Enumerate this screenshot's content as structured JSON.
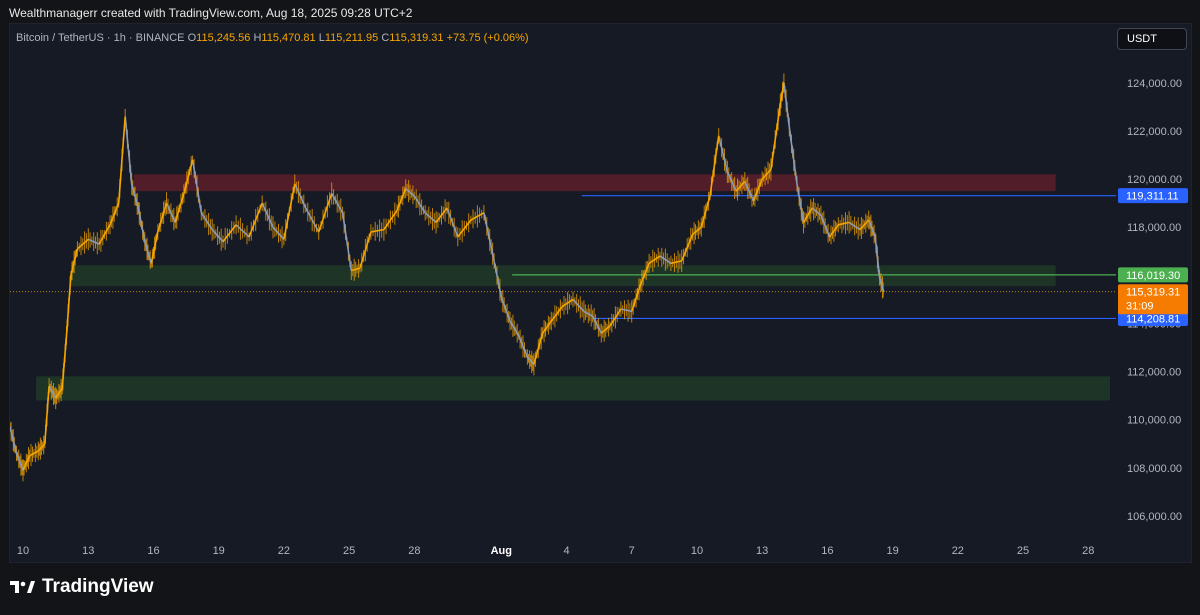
{
  "header": {
    "attribution": "Wealthmanagerr created with TradingView.com, Aug 18, 2025 09:28 UTC+2"
  },
  "symbol": {
    "name": "Bitcoin / TetherUS · 1h · BINANCE",
    "open_label": "O",
    "open": "115,245.56",
    "high_label": "H",
    "high": "115,470.81",
    "low_label": "L",
    "low": "115,211.95",
    "close_label": "C",
    "close": "115,319.31",
    "change": "+73.75 (+0.06%)"
  },
  "currency_button": "USDT",
  "logo": {
    "text": "TradingView"
  },
  "colors": {
    "background": "#161a25",
    "candle_up": "#f7a600",
    "candle_down": "#8a9bb8",
    "resistance_zone": "#5a1f29",
    "support_zone": "#1f3a28",
    "level_blue": "#2962ff",
    "level_green": "#4caf50"
  },
  "chart_data": {
    "type": "line",
    "instrument": "Bitcoin / TetherUS",
    "timeframe": "1h",
    "exchange": "BINANCE",
    "ylim": [
      105000,
      125200
    ],
    "y_ticks": [
      "106,000.00",
      "108,000.00",
      "110,000.00",
      "112,000.00",
      "114,000.00",
      "116,000.00",
      "118,000.00",
      "120,000.00",
      "122,000.00",
      "124,000.00"
    ],
    "y_tick_values": [
      106000,
      108000,
      110000,
      112000,
      114000,
      116000,
      118000,
      120000,
      122000,
      124000
    ],
    "x_ticks": [
      "10",
      "13",
      "16",
      "19",
      "22",
      "25",
      "28",
      "Aug",
      "4",
      "7",
      "10",
      "13",
      "16",
      "19",
      "22",
      "25",
      "28"
    ],
    "x_tick_days": [
      10,
      13,
      16,
      19,
      22,
      25,
      28,
      32,
      35,
      38,
      41,
      44,
      47,
      50,
      53,
      56,
      59
    ],
    "x_start_day": 9.4,
    "x_end_day": 60,
    "series": [
      {
        "points": [
          [
            9.4,
            109700
          ],
          [
            9.7,
            108600
          ],
          [
            10.0,
            107900
          ],
          [
            10.3,
            108500
          ],
          [
            10.7,
            108700
          ],
          [
            11.0,
            109000
          ],
          [
            11.2,
            111400
          ],
          [
            11.5,
            110900
          ],
          [
            11.8,
            111300
          ],
          [
            12.0,
            113500
          ],
          [
            12.2,
            116000
          ],
          [
            12.5,
            117100
          ],
          [
            13.0,
            117500
          ],
          [
            13.5,
            117300
          ],
          [
            14.0,
            118100
          ],
          [
            14.4,
            119000
          ],
          [
            14.7,
            122600
          ],
          [
            15.0,
            119800
          ],
          [
            15.3,
            118800
          ],
          [
            15.6,
            117400
          ],
          [
            15.9,
            116500
          ],
          [
            16.2,
            117800
          ],
          [
            16.6,
            119000
          ],
          [
            17.0,
            118200
          ],
          [
            17.4,
            119400
          ],
          [
            17.8,
            120800
          ],
          [
            18.2,
            118600
          ],
          [
            18.7,
            117900
          ],
          [
            19.2,
            117400
          ],
          [
            19.8,
            118100
          ],
          [
            20.4,
            117600
          ],
          [
            21.0,
            119000
          ],
          [
            21.5,
            118000
          ],
          [
            22.0,
            117500
          ],
          [
            22.5,
            119800
          ],
          [
            23.0,
            118800
          ],
          [
            23.6,
            117800
          ],
          [
            24.2,
            119400
          ],
          [
            24.7,
            118600
          ],
          [
            25.1,
            116200
          ],
          [
            25.5,
            116300
          ],
          [
            26.0,
            117800
          ],
          [
            26.6,
            117900
          ],
          [
            27.2,
            118700
          ],
          [
            27.6,
            119600
          ],
          [
            28.0,
            119300
          ],
          [
            28.5,
            118600
          ],
          [
            29.0,
            118200
          ],
          [
            29.5,
            118800
          ],
          [
            30.0,
            117600
          ],
          [
            30.6,
            118300
          ],
          [
            31.2,
            118600
          ],
          [
            31.6,
            116900
          ],
          [
            32.0,
            115100
          ],
          [
            32.4,
            114100
          ],
          [
            32.8,
            113500
          ],
          [
            33.2,
            112600
          ],
          [
            33.5,
            112300
          ],
          [
            33.9,
            113600
          ],
          [
            34.3,
            114100
          ],
          [
            34.8,
            114700
          ],
          [
            35.3,
            115000
          ],
          [
            35.8,
            114500
          ],
          [
            36.2,
            114300
          ],
          [
            36.6,
            113600
          ],
          [
            37.0,
            113900
          ],
          [
            37.5,
            114600
          ],
          [
            38.0,
            114500
          ],
          [
            38.4,
            115600
          ],
          [
            38.8,
            116500
          ],
          [
            39.3,
            116800
          ],
          [
            39.8,
            116500
          ],
          [
            40.3,
            116600
          ],
          [
            40.8,
            117700
          ],
          [
            41.2,
            118000
          ],
          [
            41.6,
            119300
          ],
          [
            42.0,
            121800
          ],
          [
            42.4,
            120300
          ],
          [
            42.8,
            119500
          ],
          [
            43.2,
            119900
          ],
          [
            43.6,
            119100
          ],
          [
            44.0,
            120000
          ],
          [
            44.4,
            120400
          ],
          [
            44.8,
            122900
          ],
          [
            45.0,
            124000
          ],
          [
            45.3,
            121800
          ],
          [
            45.6,
            119800
          ],
          [
            45.9,
            118200
          ],
          [
            46.3,
            118800
          ],
          [
            46.7,
            118500
          ],
          [
            47.1,
            117600
          ],
          [
            47.5,
            118100
          ],
          [
            48.0,
            118200
          ],
          [
            48.5,
            117900
          ],
          [
            48.9,
            118300
          ],
          [
            49.2,
            117600
          ],
          [
            49.4,
            115900
          ],
          [
            49.6,
            115300
          ]
        ]
      }
    ],
    "zones": [
      {
        "label": "resistance",
        "y_low": 119500,
        "y_high": 120200,
        "x_start": 15.1,
        "x_end": 57.5
      },
      {
        "label": "support",
        "y_low": 115550,
        "y_high": 116420,
        "x_start": 12.2,
        "x_end": 57.5
      },
      {
        "label": "support",
        "y_low": 110800,
        "y_high": 111800,
        "x_start": 10.6,
        "x_end": 60
      }
    ],
    "levels": [
      {
        "value": 119311.11,
        "label": "119,311.11",
        "x_start": 35.7,
        "color": "blue"
      },
      {
        "value": 116019.3,
        "label": "116,019.30",
        "x_start": 32.5,
        "color": "green"
      },
      {
        "value": 114208.81,
        "label": "114,208.81",
        "x_start": 36.2,
        "color": "blue"
      }
    ],
    "last_price": {
      "value": 115319.31,
      "label": "115,319.31",
      "countdown": "31:09"
    }
  }
}
